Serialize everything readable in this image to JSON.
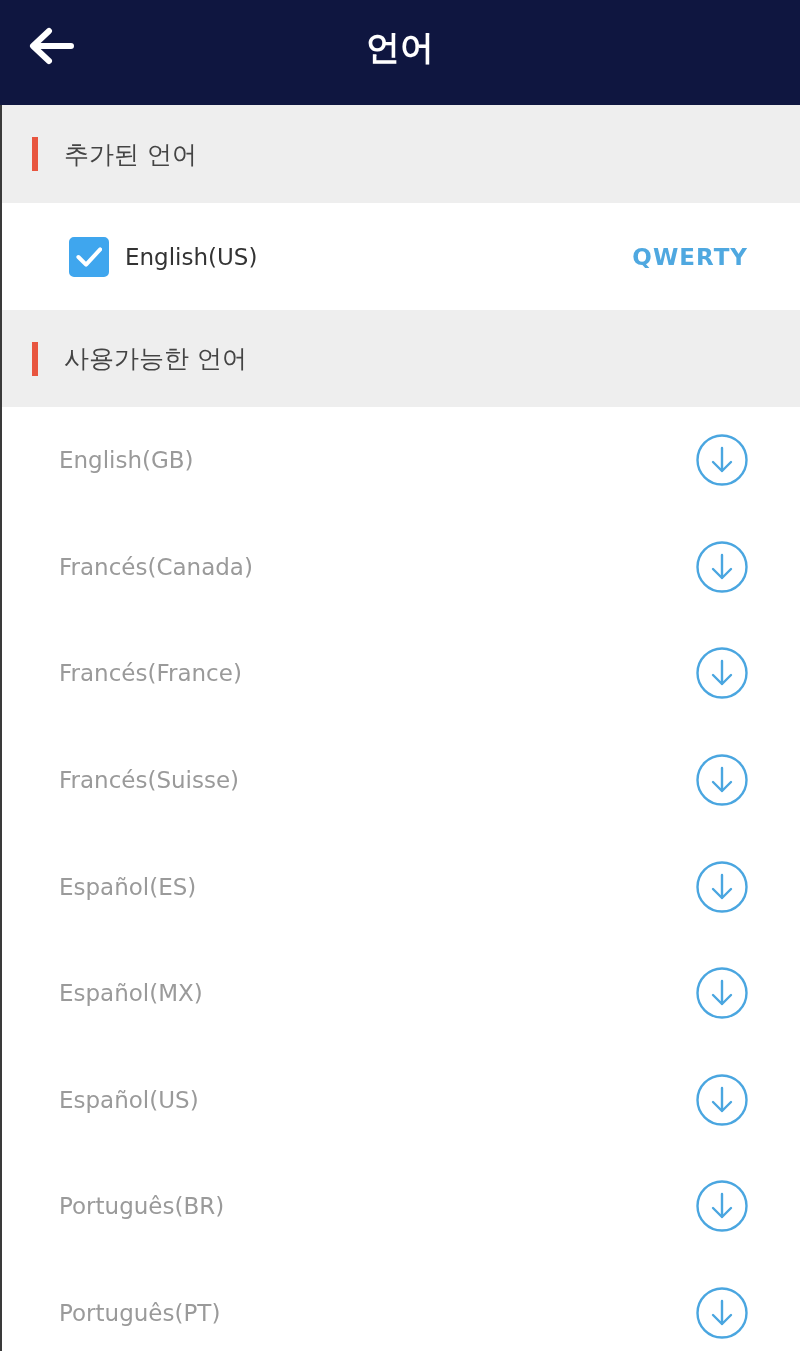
{
  "header": {
    "title": "언어"
  },
  "sections": [
    {
      "title": "추가된 언어",
      "items": [
        {
          "kind": "added",
          "label": "English(US)",
          "checked": true,
          "layout": "QWERTY"
        }
      ]
    },
    {
      "title": "사용가능한 언어",
      "items": [
        {
          "kind": "available",
          "label": "English(GB)"
        },
        {
          "kind": "available",
          "label": "Francés(Canada)"
        },
        {
          "kind": "available",
          "label": "Francés(France)"
        },
        {
          "kind": "available",
          "label": "Francés(Suisse)"
        },
        {
          "kind": "available",
          "label": "Español(ES)"
        },
        {
          "kind": "available",
          "label": "Español(MX)"
        },
        {
          "kind": "available",
          "label": "Español(US)"
        },
        {
          "kind": "available",
          "label": "Português(BR)"
        },
        {
          "kind": "available",
          "label": "Português(PT)"
        }
      ]
    }
  ]
}
